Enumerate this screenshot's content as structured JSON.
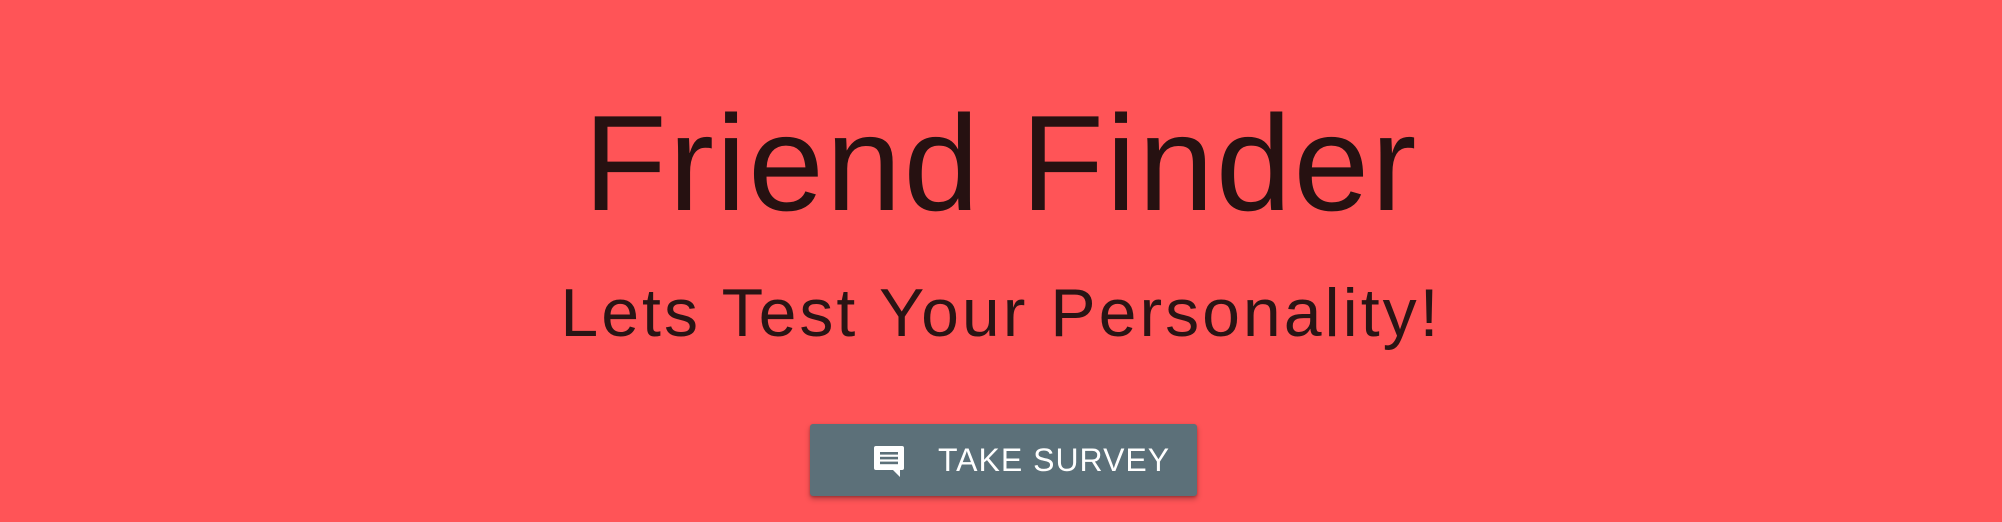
{
  "hero": {
    "title": "Friend Finder",
    "subtitle": "Lets Test Your Personality!"
  },
  "survey_button": {
    "label": "TAKE SURVEY",
    "icon": "chat-message-icon"
  },
  "colors": {
    "background": "#ff5457",
    "title_text": "#261111",
    "button": "#5c7079",
    "button_text": "#ffffff"
  }
}
